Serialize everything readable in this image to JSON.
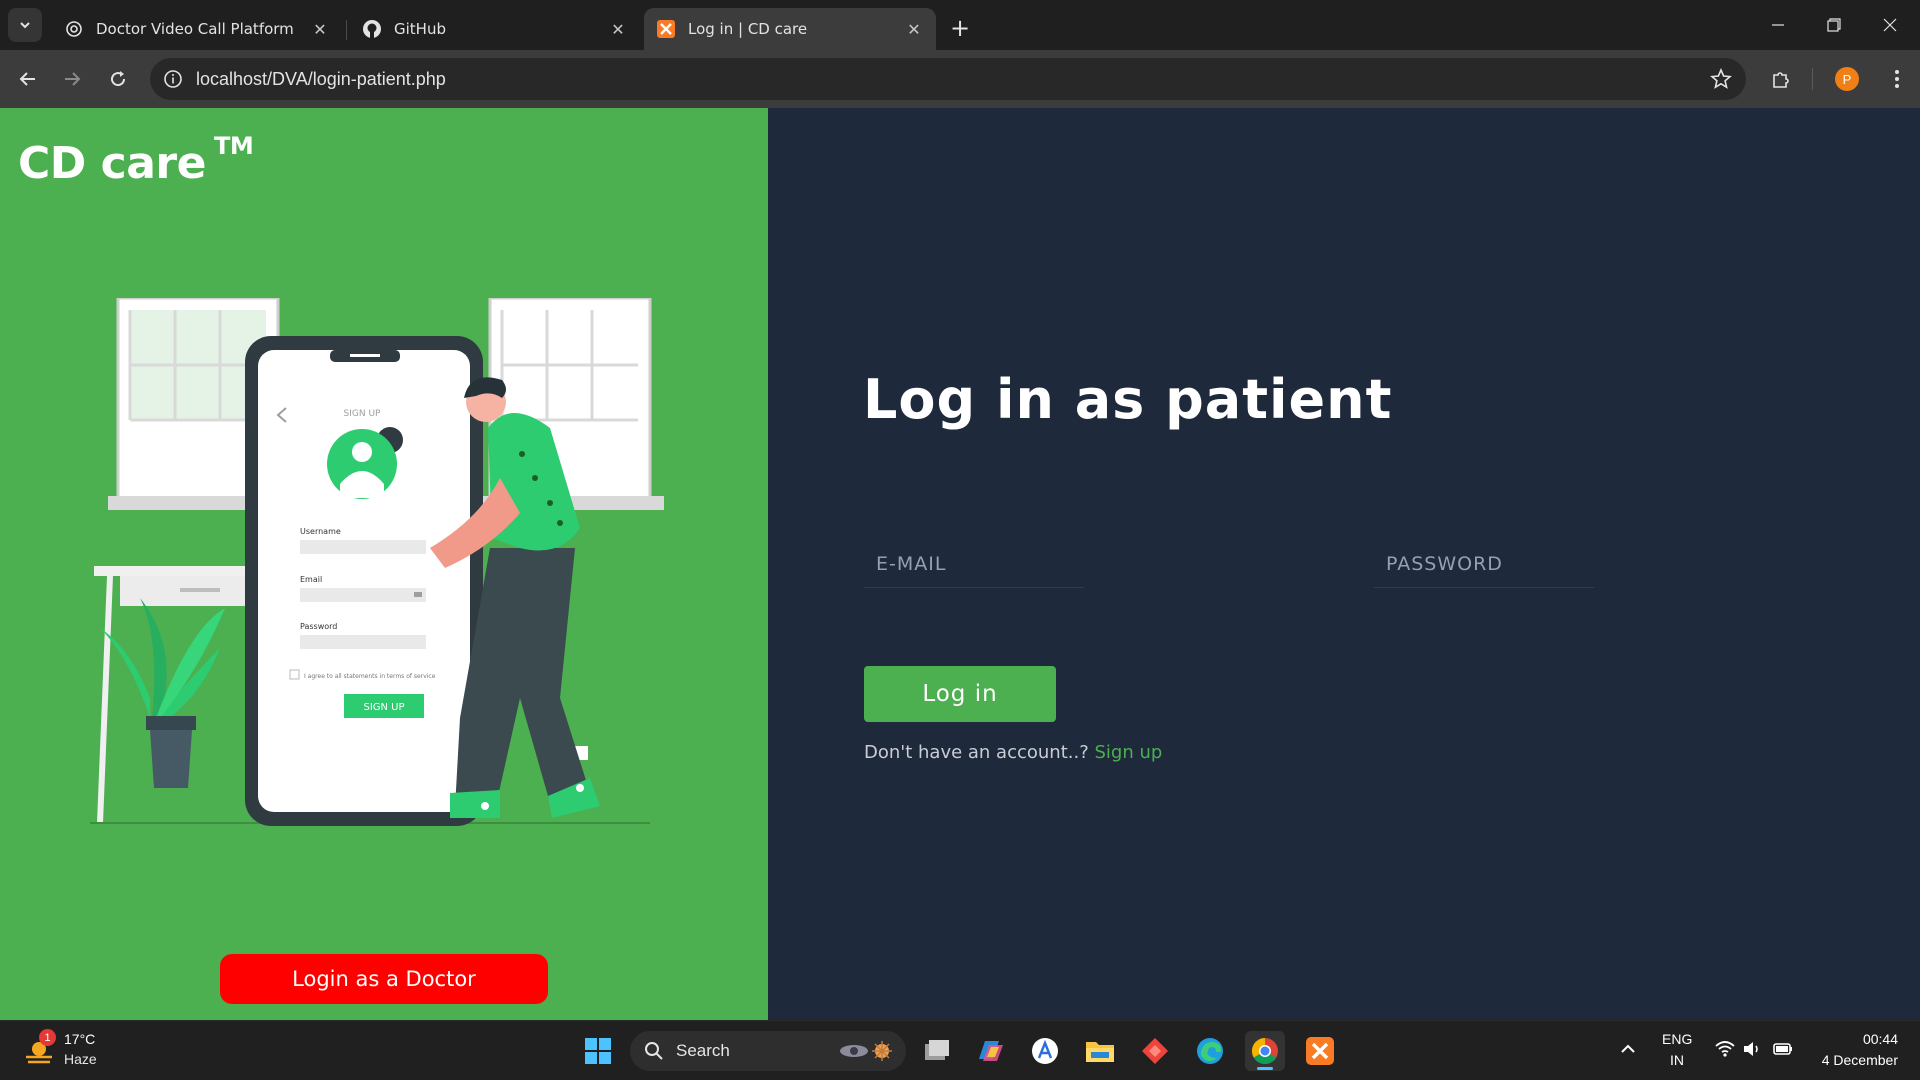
{
  "browser": {
    "tabs": [
      {
        "label": "Doctor Video Call Platform",
        "icon": "openai-icon"
      },
      {
        "label": "GitHub",
        "icon": "github-icon"
      },
      {
        "label": "Log in | CD care",
        "icon": "xampp-icon",
        "active": true
      }
    ],
    "url": "localhost/DVA/login-patient.php",
    "profile_initial": "P"
  },
  "left": {
    "brand": "CD care",
    "trademark": "TM",
    "illustration_text": {
      "screen_title": "SIGN UP",
      "username": "Username",
      "email": "Email",
      "password": "Password",
      "agree": "I agree to all statements in terms of service",
      "signup_button": "SIGN UP"
    },
    "doctor_button": "Login as a Doctor"
  },
  "right": {
    "title": "Log in as patient",
    "email_placeholder": "E-MAIL",
    "password_placeholder": "PASSWORD",
    "login_button": "Log in",
    "signup_prompt": "Don't have an account..?",
    "signup_link": "Sign up"
  },
  "taskbar": {
    "weather_temp": "17°C",
    "weather_cond": "Haze",
    "weather_badge": "1",
    "search_label": "Search",
    "lang_line1": "ENG",
    "lang_line2": "IN",
    "time": "00:44",
    "date": "4 December"
  },
  "colors": {
    "green": "#4caf50",
    "navy": "#1e293b",
    "red_button": "#ff0000",
    "accent_green": "#2ecc71"
  }
}
